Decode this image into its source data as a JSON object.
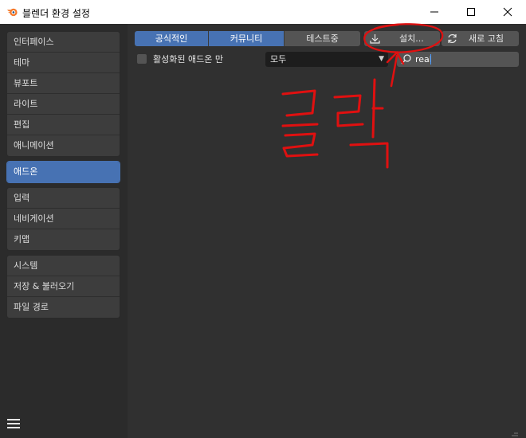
{
  "window": {
    "title": "블렌더 환경 설정",
    "minimize_icon": "minimize-icon",
    "maximize_icon": "maximize-icon",
    "close_icon": "close-icon"
  },
  "sidebar": {
    "groups": [
      {
        "items": [
          "인터페이스",
          "테마",
          "뷰포트",
          "라이트",
          "편집",
          "애니메이션"
        ]
      },
      {
        "items": [
          "애드온"
        ],
        "active": true
      },
      {
        "items": [
          "입력",
          "네비게이션",
          "키맵"
        ]
      },
      {
        "items": [
          "시스템",
          "저장 & 불러오기",
          "파일 경로"
        ]
      }
    ]
  },
  "toolbar": {
    "tabs": [
      "공식적인",
      "커뮤니티",
      "테스트중"
    ],
    "install_label": "설치...",
    "refresh_label": "새로 고침"
  },
  "filter": {
    "enabled_only_label": "활성화된 애드온 만",
    "category_value": "모두",
    "search_value": "real"
  },
  "annotation": {
    "text": "클릭"
  },
  "colors": {
    "accent": "#4772b3",
    "annotation": "#e01010"
  }
}
